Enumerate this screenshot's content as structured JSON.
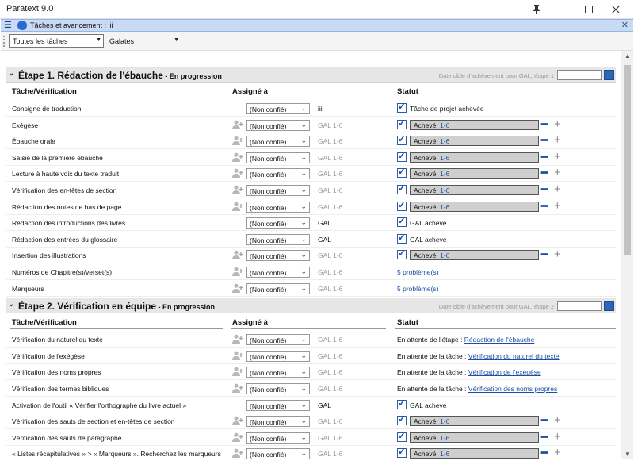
{
  "window": {
    "title": "Paratext 9.0",
    "pin_icon": "pin-icon",
    "min_icon": "minimize-icon",
    "max_icon": "maximize-icon",
    "close_icon": "close-icon"
  },
  "panel": {
    "title": "Tâches et avancement : iii",
    "menu_icon": "hamburger-icon",
    "close_label": "✕"
  },
  "toolbar": {
    "filter_value": "Toutes les tâches",
    "project_value": "Galates"
  },
  "columns": {
    "task": "Tâche/Vérification",
    "assigned": "Assigné à",
    "status": "Statut"
  },
  "stage1": {
    "title": "Étape 1. Rédaction de l'ébauche",
    "status": " - En progression",
    "target_label": "Date cible d'achèvement pour GAL, étape 1",
    "rows": [
      {
        "task": "Consigne de traduction",
        "assignee": "(Non confié)",
        "scope": "iii",
        "status_kind": "check",
        "status_text": "Tâche de projet achevée",
        "has_icon": false
      },
      {
        "task": "Exégèse",
        "assignee": "(Non confié)",
        "scope": "GAL 1-6",
        "status_kind": "progress",
        "progress_label": "Achevé:",
        "progress_range": "1-6",
        "has_icon": true
      },
      {
        "task": "Ébauche orale",
        "assignee": "(Non confié)",
        "scope": "GAL 1-6",
        "status_kind": "progress",
        "progress_label": "Achevé:",
        "progress_range": "1-6",
        "has_icon": true
      },
      {
        "task": "Saisie de la première ébauche",
        "assignee": "(Non confié)",
        "scope": "GAL 1-6",
        "status_kind": "progress",
        "progress_label": "Achevé:",
        "progress_range": "1-6",
        "has_icon": true
      },
      {
        "task": "Lecture à haute voix du texte traduit",
        "assignee": "(Non confié)",
        "scope": "GAL 1-6",
        "status_kind": "progress",
        "progress_label": "Achevé:",
        "progress_range": "1-6",
        "has_icon": true
      },
      {
        "task": "Vérification des en-têtes de section",
        "assignee": "(Non confié)",
        "scope": "GAL 1-6",
        "status_kind": "progress",
        "progress_label": "Achevé:",
        "progress_range": "1-6",
        "has_icon": true
      },
      {
        "task": "Rédaction des notes de bas de page",
        "assignee": "(Non confié)",
        "scope": "GAL 1-6",
        "status_kind": "progress",
        "progress_label": "Achevé:",
        "progress_range": "1-6",
        "has_icon": true
      },
      {
        "task": "Rédaction des introductions des livres",
        "assignee": "(Non confié)",
        "scope": "GAL",
        "status_kind": "check",
        "status_text": "GAL achevé",
        "has_icon": false
      },
      {
        "task": "Rédaction des entrées du glossaire",
        "assignee": "(Non confié)",
        "scope": "GAL",
        "status_kind": "check",
        "status_text": "GAL achevé",
        "has_icon": false
      },
      {
        "task": "Insertion des illustrations",
        "assignee": "(Non confié)",
        "scope": "GAL 1-6",
        "status_kind": "progress",
        "progress_label": "Achevé:",
        "progress_range": "1-6",
        "has_icon": true
      },
      {
        "task": "Numéros de Chapitre(s)/verset(s)",
        "assignee": "(Non confié)",
        "scope": "GAL 1-6",
        "status_kind": "blue",
        "status_text": "5 problème(s)",
        "has_icon": true
      },
      {
        "task": "Marqueurs",
        "assignee": "(Non confié)",
        "scope": "GAL 1-6",
        "status_kind": "blue",
        "status_text": "5 problème(s)",
        "has_icon": true
      }
    ]
  },
  "stage2": {
    "title": "Étape 2. Vérification en équipe",
    "status": " - En progression",
    "target_label": "Date cible d'achèvement pour GAL, étape 2",
    "rows": [
      {
        "task": "Vérification du naturel du texte",
        "assignee": "(Non confié)",
        "scope": "GAL 1-6",
        "status_kind": "wait",
        "status_text": "En attente de l'étape : ",
        "status_link": "Rédaction de l'ébauche",
        "has_icon": true
      },
      {
        "task": "Vérification de l'exégèse",
        "assignee": "(Non confié)",
        "scope": "GAL 1-6",
        "status_kind": "wait",
        "status_text": "En attente de la tâche : ",
        "status_link": "Vérification du naturel du texte",
        "has_icon": true
      },
      {
        "task": "Vérification des noms propres",
        "assignee": "(Non confié)",
        "scope": "GAL 1-6",
        "status_kind": "wait",
        "status_text": "En attente de la tâche : ",
        "status_link": "Vérification de l'exégèse",
        "has_icon": true
      },
      {
        "task": "Vérification des termes bibliques",
        "assignee": "(Non confié)",
        "scope": "GAL 1-6",
        "status_kind": "wait",
        "status_text": "En attente de la tâche : ",
        "status_link": "Vérification des noms propres",
        "has_icon": true
      },
      {
        "task": "Activation de l'outil « Vérifier l'orthographe du livre actuel »",
        "assignee": "(Non confié)",
        "scope": "GAL",
        "status_kind": "check",
        "status_text": "GAL achevé",
        "has_icon": false
      },
      {
        "task": "Vérification des sauts de section et en-têtes de section",
        "assignee": "(Non confié)",
        "scope": "GAL 1-6",
        "status_kind": "progress",
        "progress_label": "Achevé:",
        "progress_range": "1-6",
        "has_icon": true
      },
      {
        "task": "Vérification des sauts de paragraphe",
        "assignee": "(Non confié)",
        "scope": "GAL 1-6",
        "status_kind": "progress",
        "progress_label": "Achevé:",
        "progress_range": "1-6",
        "has_icon": true
      },
      {
        "task": "« Listes récapitulatives » > « Marqueurs ». Recherchez les marqueurs",
        "assignee": "(Non confié)",
        "scope": "GAL 1-6",
        "status_kind": "progress",
        "progress_label": "Achevé:",
        "progress_range": "1-6",
        "has_icon": true
      }
    ]
  },
  "colors": {
    "accent_blue": "#1a4fa3",
    "panel_header": "#c9daf5",
    "stage_bg": "#e6e6e6",
    "progress_fill": "#cfcfcf"
  }
}
